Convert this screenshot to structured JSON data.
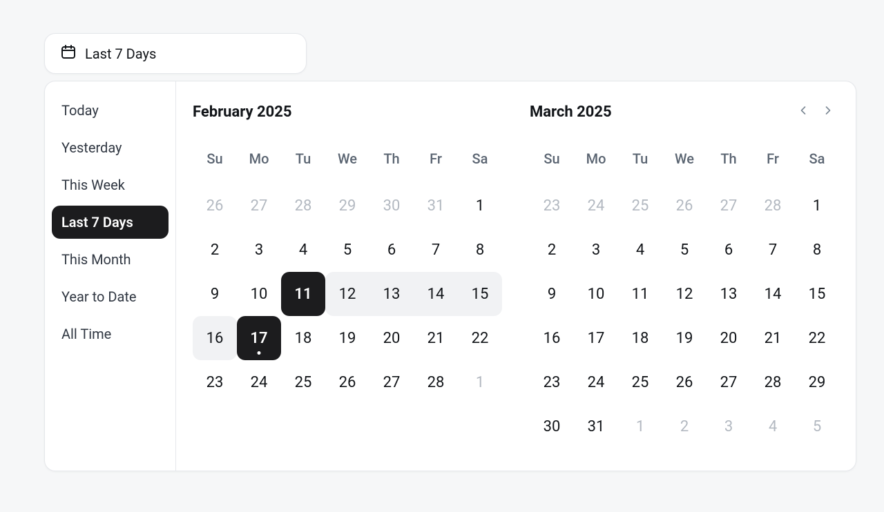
{
  "trigger": {
    "label": "Last 7 Days"
  },
  "presets": {
    "items": [
      {
        "label": "Today"
      },
      {
        "label": "Yesterday"
      },
      {
        "label": "This Week"
      },
      {
        "label": "Last 7 Days"
      },
      {
        "label": "This Month"
      },
      {
        "label": "Year to Date"
      },
      {
        "label": "All Time"
      }
    ],
    "selected_index": 3
  },
  "calendar": {
    "dow": [
      "Su",
      "Mo",
      "Tu",
      "We",
      "Th",
      "Fr",
      "Sa"
    ],
    "selection": {
      "start": "2025-02-11",
      "end": "2025-02-17"
    },
    "today": "2025-02-17",
    "months": [
      {
        "title": "February 2025",
        "year": 2025,
        "month": 2,
        "prev_nav": false,
        "next_nav": false,
        "weeks": [
          [
            {
              "d": 26,
              "out": true
            },
            {
              "d": 27,
              "out": true
            },
            {
              "d": 28,
              "out": true
            },
            {
              "d": 29,
              "out": true
            },
            {
              "d": 30,
              "out": true
            },
            {
              "d": 31,
              "out": true
            },
            {
              "d": 1
            }
          ],
          [
            {
              "d": 2
            },
            {
              "d": 3
            },
            {
              "d": 4
            },
            {
              "d": 5
            },
            {
              "d": 6
            },
            {
              "d": 7
            },
            {
              "d": 8
            }
          ],
          [
            {
              "d": 9
            },
            {
              "d": 10
            },
            {
              "d": 11
            },
            {
              "d": 12
            },
            {
              "d": 13
            },
            {
              "d": 14
            },
            {
              "d": 15
            }
          ],
          [
            {
              "d": 16
            },
            {
              "d": 17
            },
            {
              "d": 18
            },
            {
              "d": 19
            },
            {
              "d": 20
            },
            {
              "d": 21
            },
            {
              "d": 22
            }
          ],
          [
            {
              "d": 23
            },
            {
              "d": 24
            },
            {
              "d": 25
            },
            {
              "d": 26
            },
            {
              "d": 27
            },
            {
              "d": 28
            },
            {
              "d": 1,
              "out": true
            }
          ]
        ]
      },
      {
        "title": "March 2025",
        "year": 2025,
        "month": 3,
        "prev_nav": true,
        "next_nav": true,
        "weeks": [
          [
            {
              "d": 23,
              "out": true
            },
            {
              "d": 24,
              "out": true
            },
            {
              "d": 25,
              "out": true
            },
            {
              "d": 26,
              "out": true
            },
            {
              "d": 27,
              "out": true
            },
            {
              "d": 28,
              "out": true
            },
            {
              "d": 1
            }
          ],
          [
            {
              "d": 2
            },
            {
              "d": 3
            },
            {
              "d": 4
            },
            {
              "d": 5
            },
            {
              "d": 6
            },
            {
              "d": 7
            },
            {
              "d": 8
            }
          ],
          [
            {
              "d": 9
            },
            {
              "d": 10
            },
            {
              "d": 11
            },
            {
              "d": 12
            },
            {
              "d": 13
            },
            {
              "d": 14
            },
            {
              "d": 15
            }
          ],
          [
            {
              "d": 16
            },
            {
              "d": 17
            },
            {
              "d": 18
            },
            {
              "d": 19
            },
            {
              "d": 20
            },
            {
              "d": 21
            },
            {
              "d": 22
            }
          ],
          [
            {
              "d": 23
            },
            {
              "d": 24
            },
            {
              "d": 25
            },
            {
              "d": 26
            },
            {
              "d": 27
            },
            {
              "d": 28
            },
            {
              "d": 29
            }
          ],
          [
            {
              "d": 30
            },
            {
              "d": 31
            },
            {
              "d": 1,
              "out": true
            },
            {
              "d": 2,
              "out": true
            },
            {
              "d": 3,
              "out": true
            },
            {
              "d": 4,
              "out": true
            },
            {
              "d": 5,
              "out": true
            }
          ]
        ]
      }
    ]
  }
}
